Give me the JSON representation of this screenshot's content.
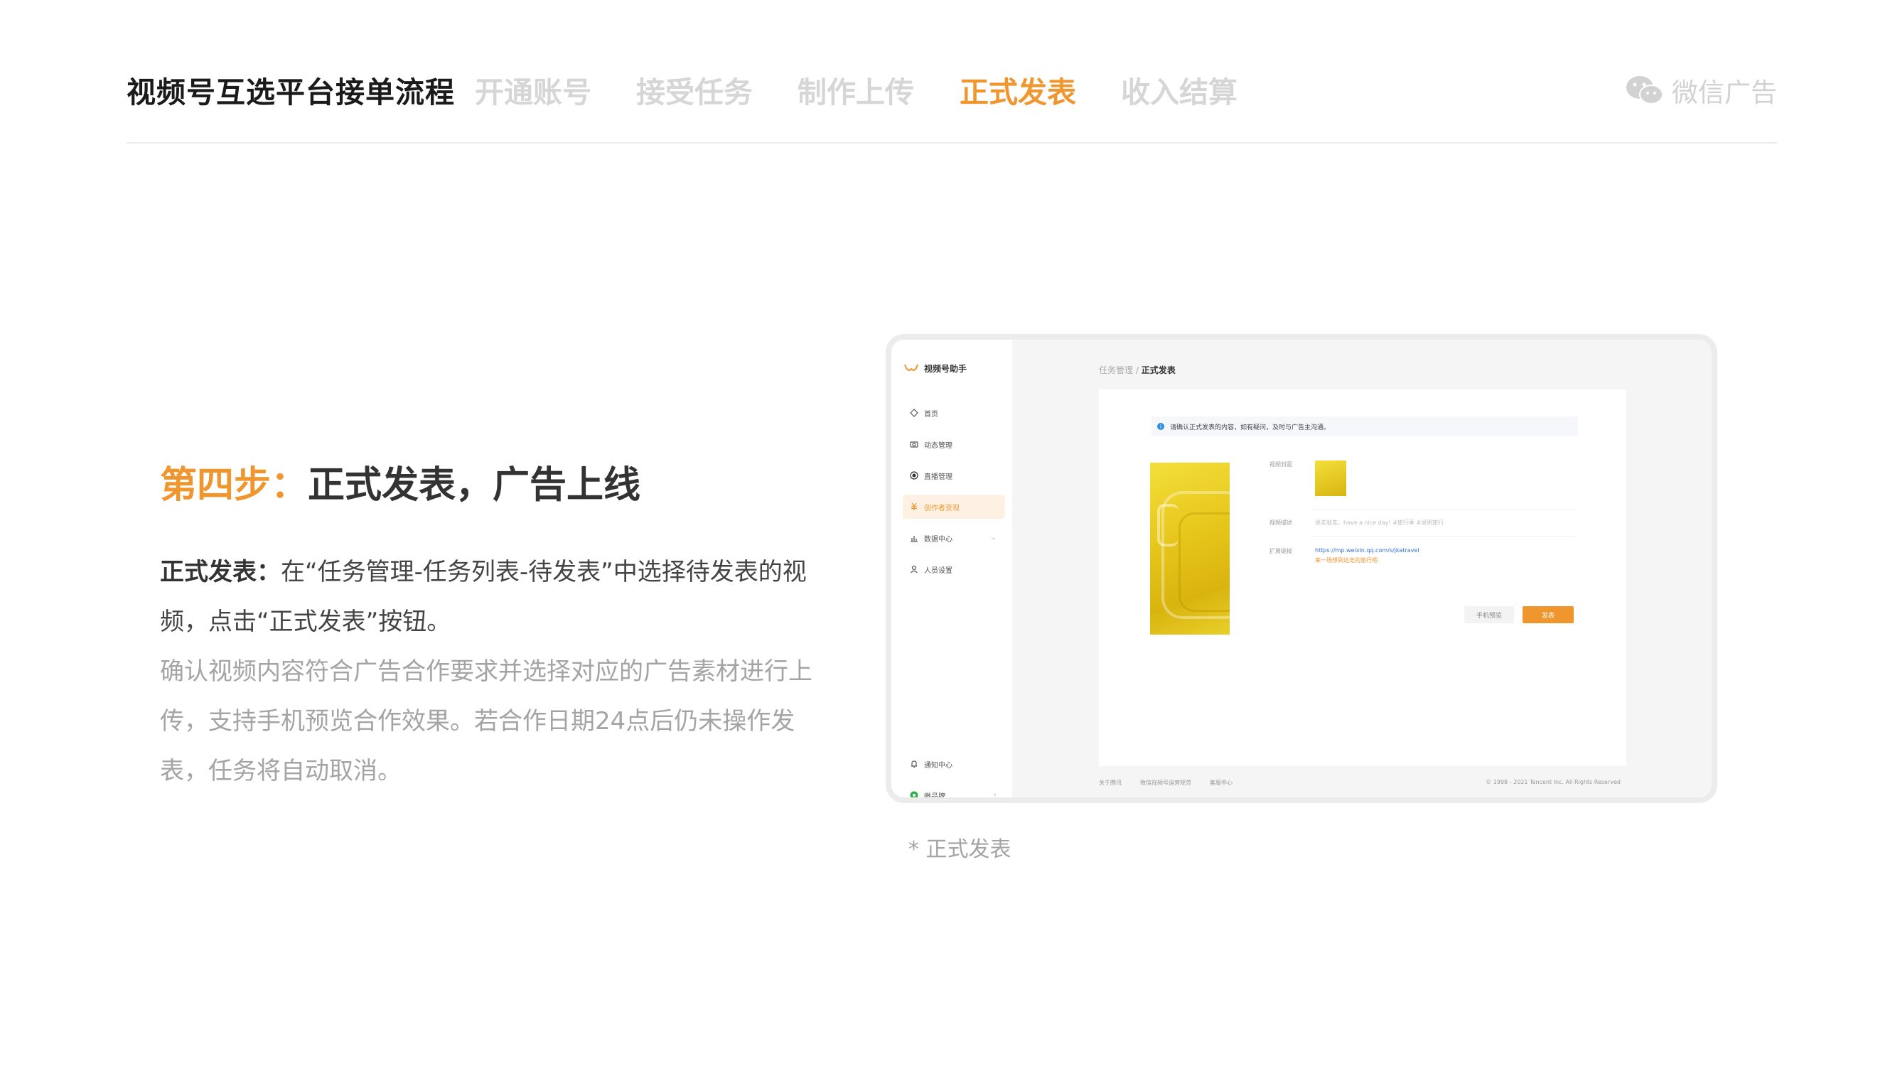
{
  "header": {
    "title": "视频号互选平台接单流程",
    "steps": [
      {
        "label": "开通账号",
        "active": false
      },
      {
        "label": "接受任务",
        "active": false
      },
      {
        "label": "制作上传",
        "active": false
      },
      {
        "label": "正式发表",
        "active": true
      },
      {
        "label": "收入结算",
        "active": false
      }
    ],
    "brand": "微信广告"
  },
  "section": {
    "step_num": "第四步：",
    "step_title": "正式发表，广告上线",
    "desc_strong": "正式发表：",
    "desc_main": "在“任务管理-任务列表-待发表”中选择待发表的视频，点击“正式发表”按钮。",
    "desc_sub": "确认视频内容符合广告合作要求并选择对应的广告素材进行上传，支持手机预览合作效果。若合作日期24点后仍未操作发表，任务将自动取消。"
  },
  "screenshot": {
    "app_name": "视频号助手",
    "sidebar": [
      {
        "label": "首页",
        "icon": "home-icon"
      },
      {
        "label": "动态管理",
        "icon": "camera-icon"
      },
      {
        "label": "直播管理",
        "icon": "live-icon"
      },
      {
        "label": "创作者变现",
        "icon": "money-icon",
        "active": true
      },
      {
        "label": "数据中心",
        "icon": "chart-icon"
      },
      {
        "label": "人员设置",
        "icon": "user-icon"
      }
    ],
    "sidebar_bottom": [
      {
        "label": "通知中心",
        "icon": "bell-icon"
      },
      {
        "label": "微品牌",
        "icon": "brand-icon"
      }
    ],
    "breadcrumb_parent": "任务管理",
    "breadcrumb_sep": "/",
    "breadcrumb_current": "正式发表",
    "notice": "请确认正式发表的内容，如有疑问，及时与广告主沟通。",
    "form": {
      "cover_label": "视频封面",
      "desc_label": "视频描述",
      "desc_value": "说走就走，have a nice day! #旅行季 #说明旅行",
      "ext_label": "扩展链接",
      "ext_value": "https://mp.weixin.qq.com/s/jkatravel",
      "ext_note": "来一场想到达走的旅行吧"
    },
    "btn_preview": "手机预览",
    "btn_publish": "发表",
    "footer_links": [
      "关于腾讯",
      "微信视频号运营规范",
      "客服中心"
    ],
    "copyright": "© 1998 - 2021 Tencent Inc. All Rights Reserved"
  },
  "caption": "* 正式发表",
  "colors": {
    "accent": "#f0962f",
    "muted": "#d6d6d6",
    "text": "#333333"
  }
}
